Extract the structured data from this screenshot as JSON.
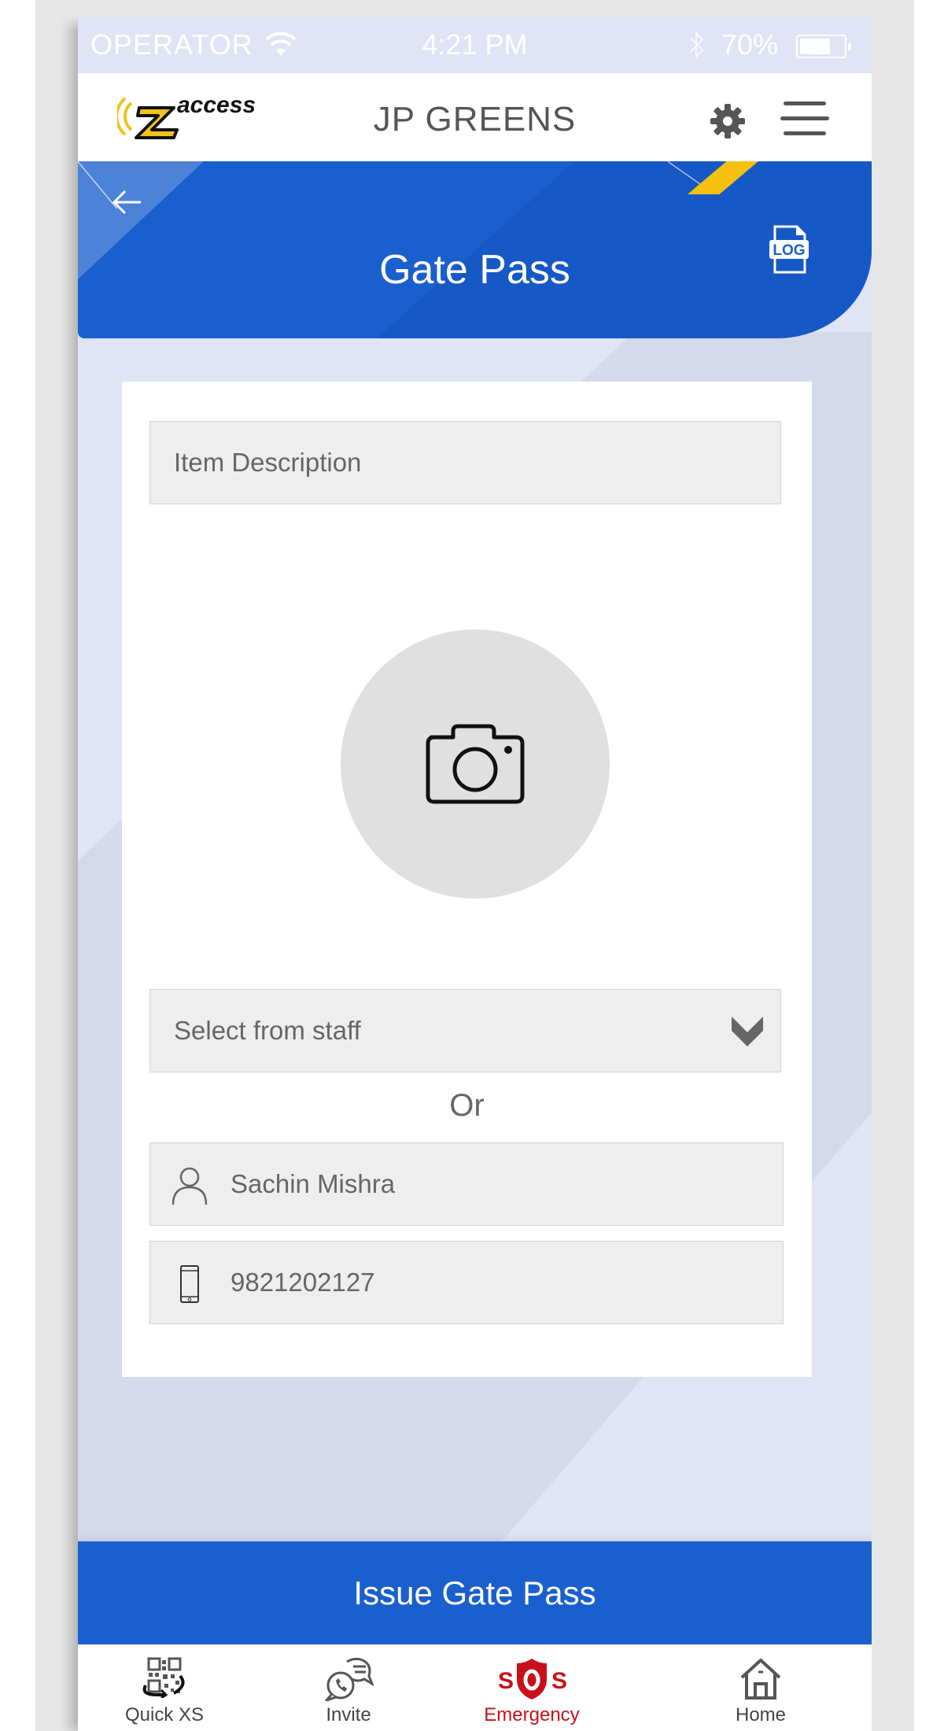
{
  "status_bar": {
    "carrier": "OPERATOR",
    "time": "4:21 PM",
    "battery_percent_label": "70%",
    "battery_level": 0.7,
    "icons": [
      "wifi-icon",
      "bluetooth-icon",
      "battery-icon"
    ]
  },
  "header": {
    "logo_text": "access",
    "title": "JP GREENS",
    "icons": [
      "settings-gear-icon",
      "hamburger-menu-icon"
    ]
  },
  "banner": {
    "title": "Gate Pass",
    "back_icon": "arrow-left-icon",
    "log_icon": "log-file-icon",
    "log_label": "LOG"
  },
  "form": {
    "item_description": {
      "placeholder": "Item Description",
      "value": ""
    },
    "photo": {
      "icon": "camera-icon"
    },
    "staff_select": {
      "placeholder": "Select from staff",
      "icon": "chevron-down-icon"
    },
    "or_label": "Or",
    "name_field": {
      "value": "Sachin Mishra",
      "icon": "user-icon"
    },
    "phone_field": {
      "value": "9821202127",
      "icon": "mobile-phone-icon"
    }
  },
  "actions": {
    "issue_label": "Issue Gate Pass"
  },
  "bottom_nav": {
    "items": [
      {
        "label": "Quick XS",
        "icon": "qr-code-icon",
        "active": false
      },
      {
        "label": "Invite",
        "icon": "chat-bubbles-icon",
        "active": false
      },
      {
        "label": "Emergency",
        "icon": "sos-shield-icon",
        "active": true,
        "badge_text": "SOS"
      },
      {
        "label": "Home",
        "icon": "home-icon",
        "active": false
      }
    ]
  },
  "colors": {
    "primary_blue": "#1a5fce",
    "accent_yellow": "#f5c010",
    "emergency_red": "#c8101a",
    "background": "#e0e4f5",
    "field_bg": "#eeeeee"
  }
}
